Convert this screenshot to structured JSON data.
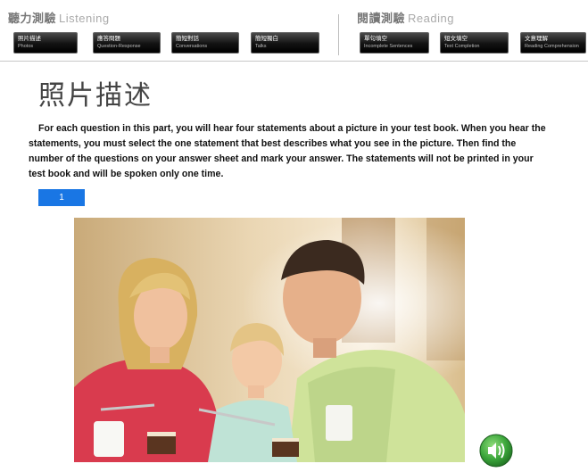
{
  "nav": {
    "listening": {
      "zh": "聽力測驗",
      "en": "Listening"
    },
    "reading": {
      "zh": "閱讀測驗",
      "en": "Reading"
    },
    "listening_items": [
      {
        "zh": "照片描述",
        "en": "Photos"
      },
      {
        "zh": "應答問題",
        "en": "Question-Response"
      },
      {
        "zh": "簡短對話",
        "en": "Conversations"
      },
      {
        "zh": "簡短獨白",
        "en": "Talks"
      }
    ],
    "reading_items": [
      {
        "zh": "單句填空",
        "en": "Incomplete Sentences"
      },
      {
        "zh": "短文填空",
        "en": "Text Completion"
      },
      {
        "zh": "文意理解",
        "en": "Reading Comprehension"
      }
    ]
  },
  "main": {
    "title": "照片描述",
    "instructions": "For each question in this part, you will hear four statements about a picture in your test book. When you hear the statements, you must select the one statement that best describes what you see in the picture. Then find the number of the questions on your answer sheet and mark your answer. The statements will not be printed in your test book and will be spoken only one time.",
    "question_tab": "1"
  },
  "colors": {
    "accent": "#1976e4",
    "nav_button": "#111111",
    "audio_button": "#3aa53a"
  },
  "icons": {
    "audio": "speaker-icon"
  }
}
